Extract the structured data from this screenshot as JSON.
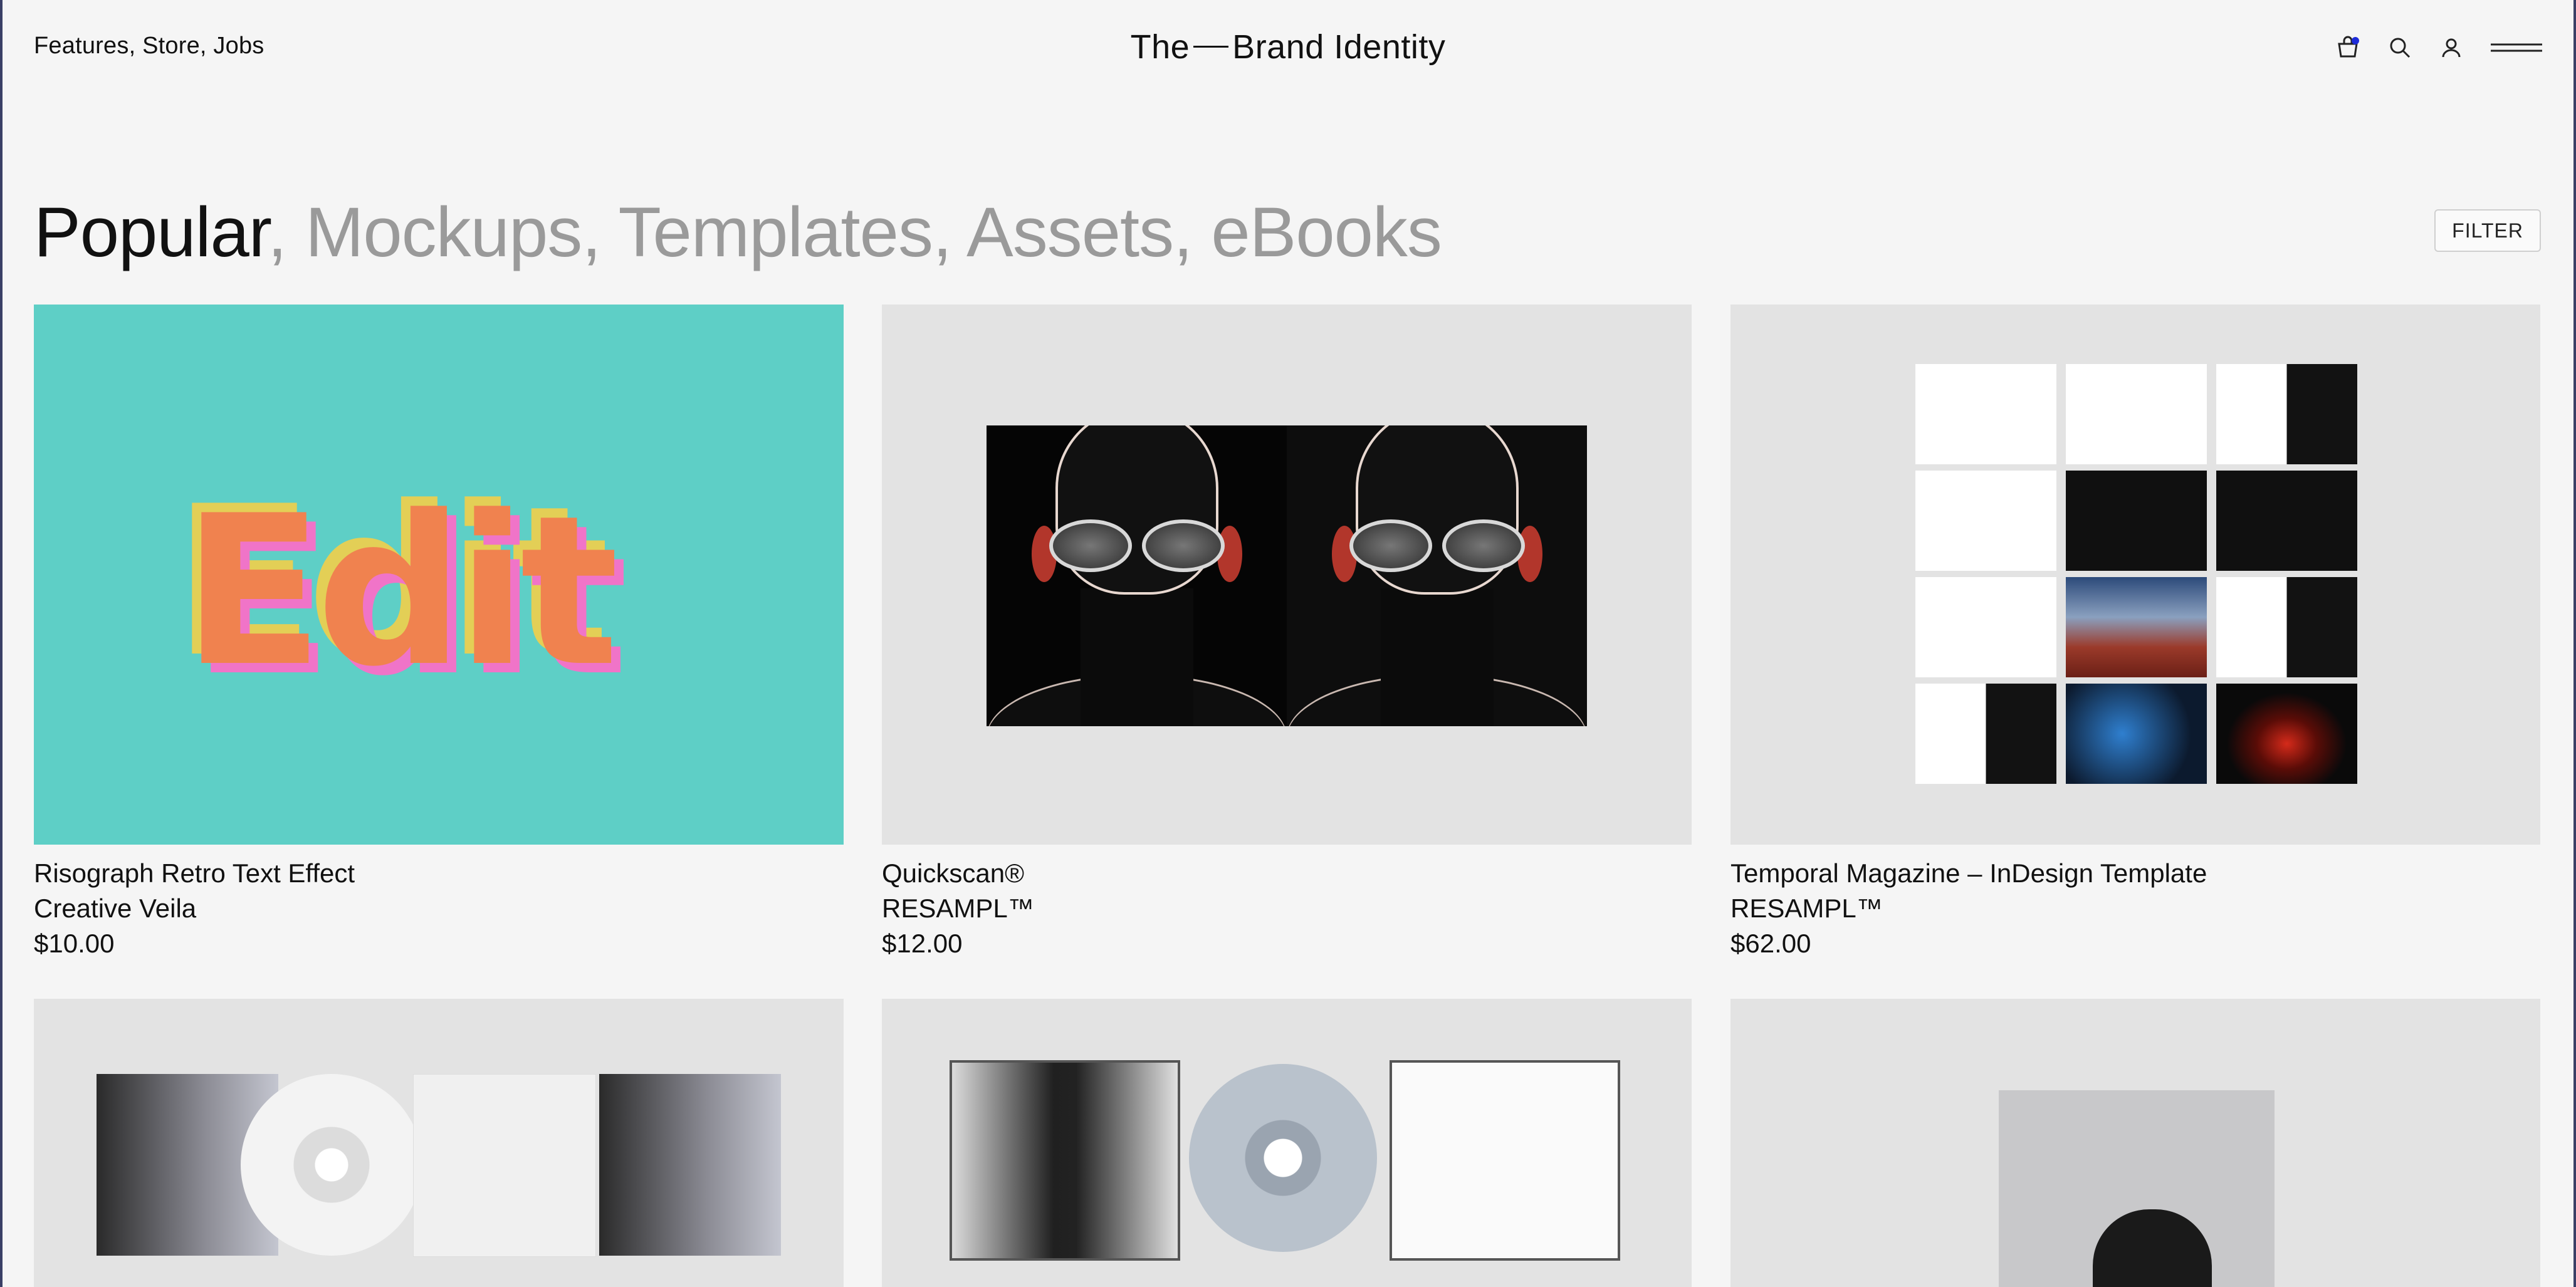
{
  "header": {
    "nav_links": [
      "Features",
      "Store",
      "Jobs"
    ],
    "nav_sep": ", ",
    "brand_left": "The",
    "brand_right": "Brand Identity",
    "icons": [
      "cart-icon",
      "search-icon",
      "account-icon",
      "menu-icon"
    ],
    "cart_badge_color": "#1d2bd8"
  },
  "categories": {
    "active": "Popular",
    "others": [
      "Mockups",
      "Templates",
      "Assets",
      "eBooks"
    ],
    "separator": ", "
  },
  "filter_label": "FILTER",
  "products": [
    {
      "title": "Risograph Retro Text Effect",
      "vendor": "Creative Veila",
      "price": "$10.00",
      "thumb_text": "Edit"
    },
    {
      "title": "Quickscan®",
      "vendor": "RESAMPL™",
      "price": "$12.00"
    },
    {
      "title": "Temporal Magazine – InDesign Template",
      "vendor": "RESAMPL™",
      "price": "$62.00"
    }
  ],
  "colors": {
    "background": "#f5f5f5",
    "muted_text": "#9a9a9a",
    "riso_bg": "#5ecfc6"
  }
}
